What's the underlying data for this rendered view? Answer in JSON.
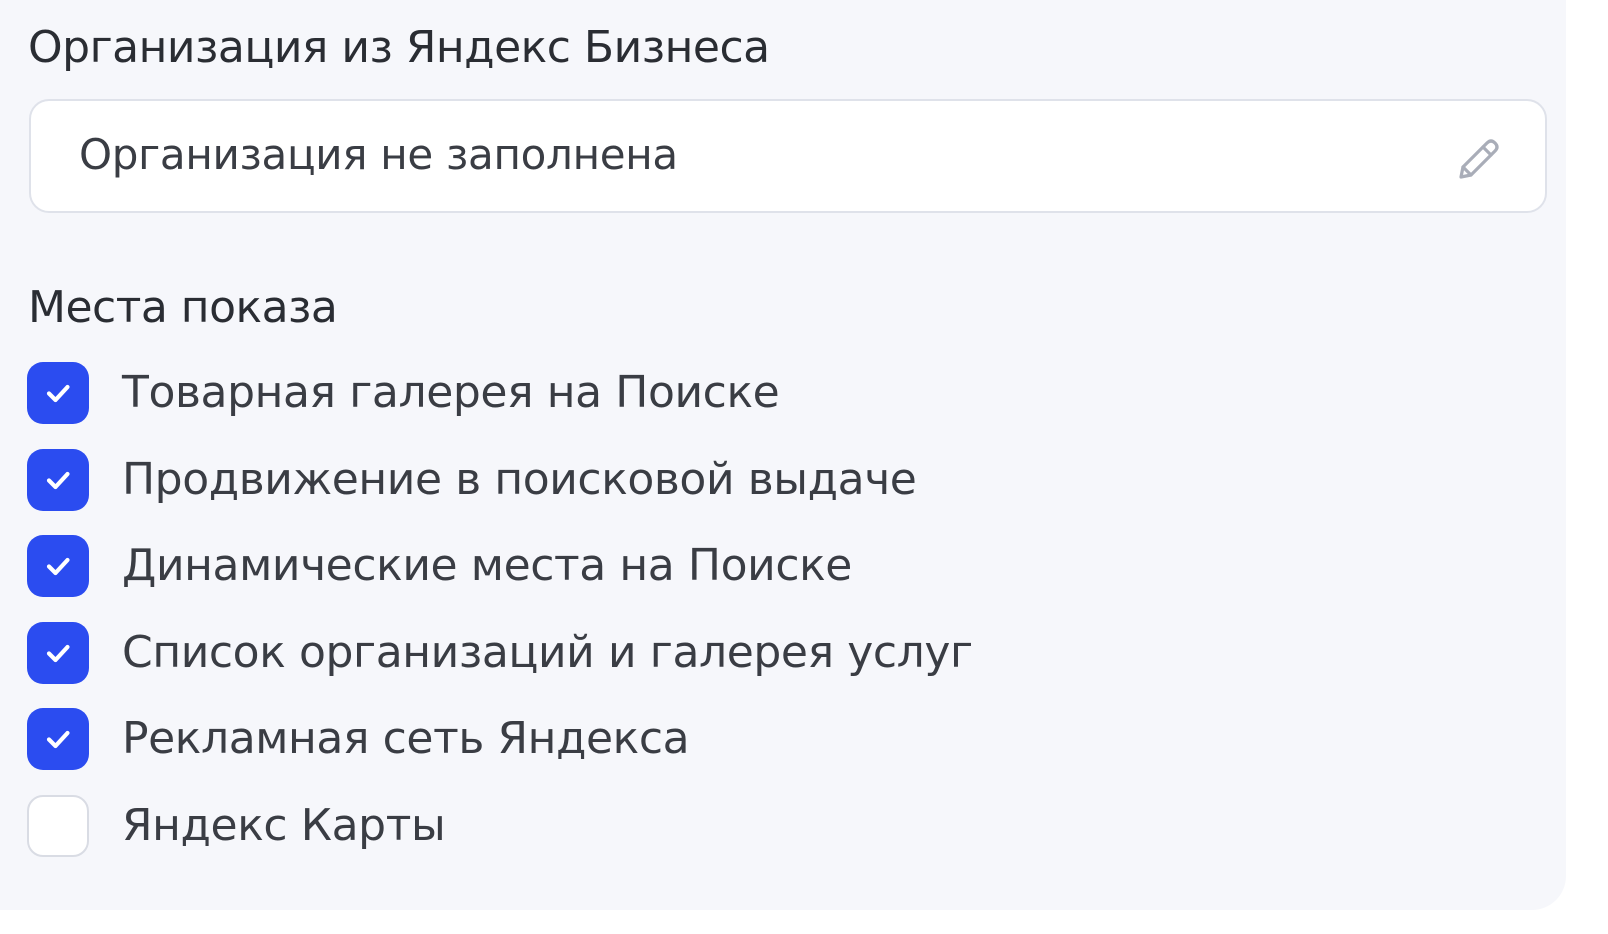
{
  "organization": {
    "title": "Организация из Яндекс Бизнеса",
    "field_value": "Организация не заполнена",
    "edit_icon": "pencil-icon"
  },
  "placements": {
    "title": "Места показа",
    "items": [
      {
        "label": "Товарная галерея на Поиске",
        "checked": true
      },
      {
        "label": "Продвижение в поисковой выдаче",
        "checked": true
      },
      {
        "label": "Динамические места на Поиске",
        "checked": true
      },
      {
        "label": "Список организаций и галерея услуг",
        "checked": true
      },
      {
        "label": "Рекламная сеть Яндекса",
        "checked": true
      },
      {
        "label": "Яндекс Карты",
        "checked": false
      }
    ]
  },
  "colors": {
    "background": "#f6f7fb",
    "accent": "#2b4cf0",
    "text": "#2a2d33",
    "field_border": "#dfe2ea"
  }
}
